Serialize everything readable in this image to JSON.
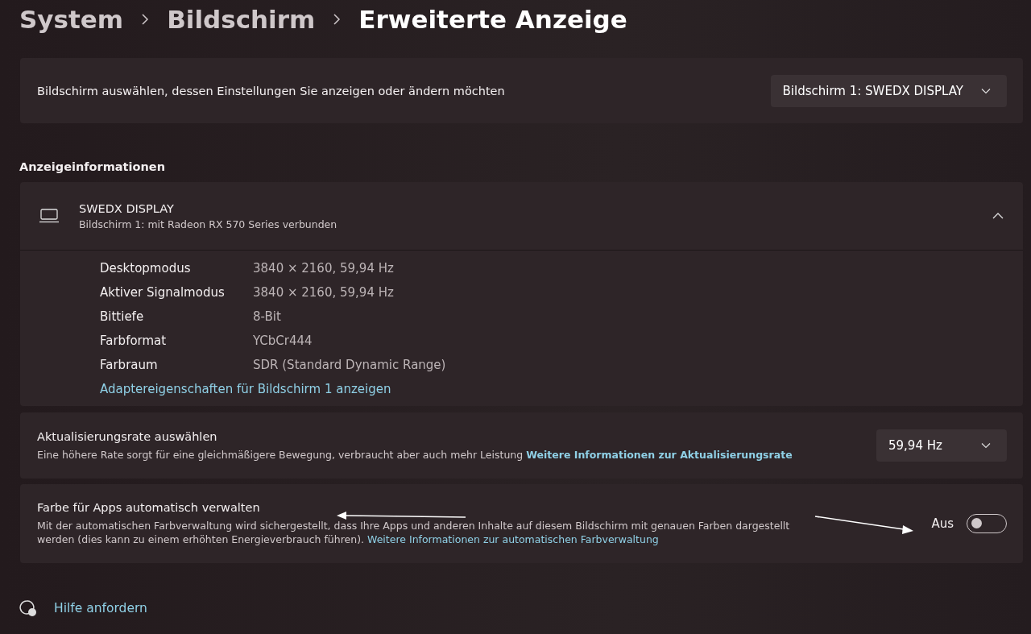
{
  "breadcrumb": [
    {
      "label": "System",
      "selected": false
    },
    {
      "label": "Bildschirm",
      "selected": false
    },
    {
      "label": "Erweiterte Anzeige",
      "selected": true
    }
  ],
  "display_select": {
    "label": "Bildschirm auswählen, dessen Einstellungen Sie anzeigen oder ändern möchten",
    "value": "Bildschirm 1: SWEDX DISPLAY"
  },
  "section_title": "Anzeigeinformationen",
  "display_info": {
    "name": "SWEDX DISPLAY",
    "subtitle": "Bildschirm 1: mit Radeon RX 570 Series verbunden",
    "expanded": true,
    "rows": [
      {
        "label": "Desktopmodus",
        "value": "3840 × 2160, 59,94 Hz"
      },
      {
        "label": "Aktiver Signalmodus",
        "value": "3840 × 2160, 59,94 Hz"
      },
      {
        "label": "Bittiefe",
        "value": "8-Bit"
      },
      {
        "label": "Farbformat",
        "value": "YCbCr444"
      },
      {
        "label": "Farbraum",
        "value": "SDR (Standard Dynamic Range)"
      }
    ],
    "link": "Adaptereigenschaften für Bildschirm 1 anzeigen"
  },
  "refresh_rate": {
    "title": "Aktualisierungsrate auswählen",
    "description": "Eine höhere Rate sorgt für eine gleichmäßigere Bewegung, verbraucht aber auch mehr Leistung",
    "link": "Weitere Informationen zur Aktualisierungsrate",
    "value": "59,94 Hz"
  },
  "auto_color": {
    "title": "Farbe für Apps automatisch verwalten",
    "description": "Mit der automatischen Farbverwaltung wird sichergestellt, dass Ihre Apps und anderen Inhalte auf diesem Bildschirm mit genauen Farben dargestellt werden (dies kann zu einem erhöhten Energieverbrauch führen).",
    "link": "Weitere Informationen zur automatischen Farbverwaltung",
    "toggle_label": "Aus",
    "on": false
  },
  "help_link": "Hilfe anfordern"
}
